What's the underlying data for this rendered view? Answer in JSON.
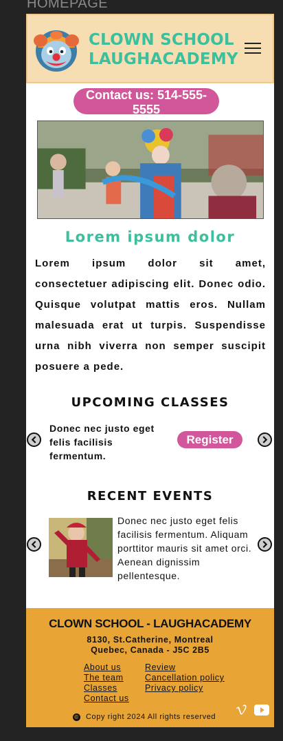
{
  "page_label": "HOMEPAGE",
  "header": {
    "brand_line1": "CLOWN SCHOOL",
    "brand_line2": "LAUGHACADEMY",
    "menu_icon": "hamburger-menu-icon"
  },
  "contact": {
    "label": "Contact us: 514-555-5555"
  },
  "intro": {
    "title": "Lorem ipsum dolor",
    "text": "Lorem ipsum dolor sit amet, consectetuer adipiscing elit. Donec odio. Quisque volutpat mattis eros. Nullam malesuada erat ut turpis. Suspendisse urna nibh viverra non semper suscipit posuere a pede."
  },
  "upcoming": {
    "title": "UPCOMING CLASSES",
    "text": "Donec nec justo eget felis facilisis fermentum.",
    "register_label": "Register"
  },
  "events": {
    "title": "RECENT EVENTS",
    "text": "Donec nec justo eget felis facilisis fermentum. Aliquam porttitor mauris sit amet orci. Aenean dignissim pellentesque."
  },
  "footer": {
    "title": "CLOWN SCHOOL - LAUGHACADEMY",
    "address_line1": "8130, St.Catherine, Montreal",
    "address_line2": "Quebec, Canada - J5C 2B5",
    "links_left": [
      "About us",
      "The team",
      "Classes",
      "Contact us"
    ],
    "links_right": [
      "Review",
      "Cancellation policy",
      "Privacy policy"
    ],
    "copyright": "Copy right 2024 All rights reserved"
  },
  "colors": {
    "header_bg": "#f7deb2",
    "accent_teal": "#3cbf9c",
    "accent_pink": "#d1569a",
    "footer_bg": "#e9a436"
  }
}
